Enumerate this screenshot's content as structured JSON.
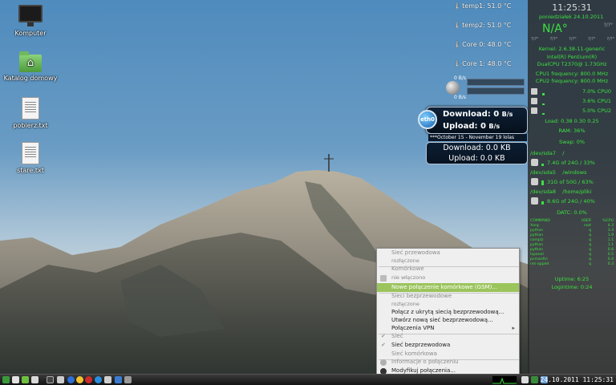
{
  "desktop": {
    "icons": [
      {
        "label": "Komputer",
        "icon": "monitor-icon"
      },
      {
        "label": "Katalog domowy",
        "icon": "home-folder-icon"
      },
      {
        "label": "pobierz.txt",
        "icon": "text-file-icon"
      },
      {
        "label": "stare.txt",
        "icon": "text-file-icon"
      }
    ]
  },
  "temps": [
    "temp1: 51.0 °C",
    "temp2: 51.0 °C",
    "Core 0: 48.0 °C",
    "Core 1: 48.0 °C"
  ],
  "netgraph": {
    "down": "0 B/s",
    "up": "0 B/s"
  },
  "eth": {
    "iface": "eth0",
    "download_label": "Download: 0",
    "download_unit": "B/s",
    "upload_label": "Upload: 0",
    "upload_unit": "B/s"
  },
  "dates_banner": "***October 15 - November 19 lolas",
  "kb": {
    "download": "Download: 0.0 KB",
    "upload": "Upload: 0.0 KB"
  },
  "conky": {
    "clock": "11:25:31",
    "date": "poniedziałek 24.10.2011",
    "weather": "N/A°",
    "weather_q": "?/?°",
    "q_row": [
      "?/?°",
      "?/?°",
      "?/?°",
      "?/?°",
      "?/?°"
    ],
    "kernel": "Kernel: 2.6.38-11-generic",
    "cpu_name": "Intel(R) Pentium(R)",
    "cpu_model": "DualCPU T2370@ 1.73GHz",
    "cpu1_freq": "CPU1 frequency: 800.0 MHz",
    "cpu2_freq": "CPU2 frequency: 800.0 MHz",
    "cpus": [
      {
        "value": "7.0% CPU0",
        "level": 0.07
      },
      {
        "value": "3.6% CPU1",
        "level": 0.036
      },
      {
        "value": "5.0% CPU2",
        "level": 0.05
      }
    ],
    "load": "Load: 0.38 0.30 0.25",
    "ram": "RAM: 36%",
    "swap": "Swap: 0%",
    "disks": [
      {
        "dev": "/dev/sda7",
        "mount": "/",
        "usage": "7.4G of 24G / 33%",
        "level": 0.33
      },
      {
        "dev": "/dev/sda5",
        "mount": "/windows",
        "usage": "31G of 50G / 63%",
        "level": 0.63
      },
      {
        "dev": "/dev/sda8",
        "mount": "/home/pliki",
        "usage": "8.6G of 24G / 40%",
        "level": 0.4
      }
    ],
    "dato": "DATC: 0.0%",
    "proc_headers": [
      "COMMAND",
      "USER",
      "%CPU"
    ],
    "procs": [
      [
        "Xorg",
        "root",
        "4.3"
      ],
      [
        "python",
        "q",
        "3.3"
      ],
      [
        "python",
        "q",
        "1.9"
      ],
      [
        "compiz",
        "q",
        "1.1"
      ],
      [
        "python",
        "q",
        "1.1"
      ],
      [
        "python",
        "q",
        "0.8"
      ],
      [
        "lxpanel",
        "q",
        "0.5"
      ],
      [
        "pcmanfm",
        "q",
        "0.4"
      ],
      [
        "nm-applet",
        "q",
        "0.3"
      ]
    ],
    "uptime": "Uptime: 6:25",
    "logintime": "Logintime: 0:24"
  },
  "menu": {
    "items": [
      {
        "label": "Sieć przewodowa",
        "style": "dis"
      },
      {
        "label": "rozłączone",
        "style": "sub"
      },
      {
        "label": "Komórkowe",
        "style": "dis"
      },
      {
        "label": "nie włączono",
        "style": "sub",
        "icon": "signal-bars-icon"
      },
      {
        "label": "Nowe połączenie komórkowe (GSM)...",
        "style": "hl"
      },
      {
        "label": "Sieci bezprzewodowe",
        "style": "dis"
      },
      {
        "label": "rozłączone",
        "style": "sub"
      },
      {
        "label": "Połącz z ukrytą siecią bezprzewodową...",
        "style": "normal"
      },
      {
        "label": "Utwórz nową sieć bezprzewodową...",
        "style": "normal"
      },
      {
        "label": "Połączenia VPN",
        "style": "normal",
        "arrow": "▸"
      },
      {
        "label": "Sieć",
        "style": "dis",
        "check": "✔"
      },
      {
        "label": "Sieć bezprzewodowa",
        "style": "normal",
        "check": "✔"
      },
      {
        "label": "Sieć komórkowa",
        "style": "dis"
      },
      {
        "label": "Informacje o połączeniu",
        "style": "dis",
        "icon": "info-icon"
      },
      {
        "label": "Modyfikuj połączenia...",
        "style": "normal",
        "icon": "edit-icon"
      }
    ]
  },
  "taskbar": {
    "clock": "24.10.2011 11:25:31",
    "launchers": [
      "menu-icon",
      "files-icon",
      "terminal-icon",
      "browser-icon",
      "chat-icon",
      "mail-icon",
      "music-icon",
      "skype-icon",
      "settings-icon",
      "tools-icon"
    ]
  }
}
